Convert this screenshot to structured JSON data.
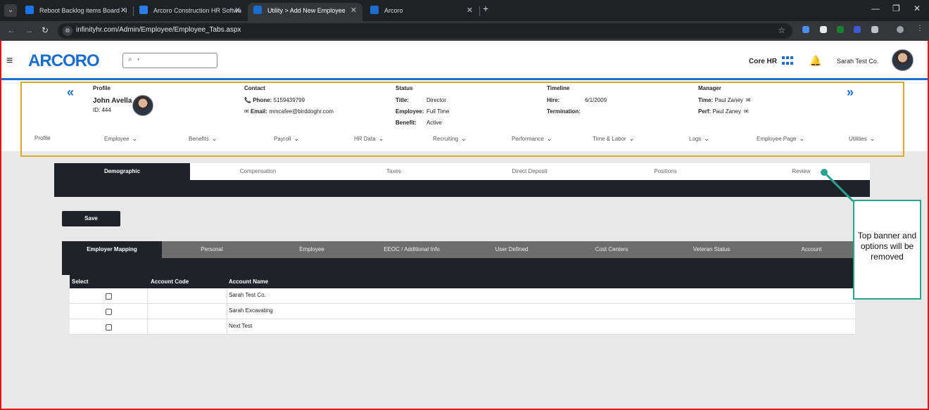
{
  "browser": {
    "tabs": [
      {
        "title": "Reboot Backlog items Board - I",
        "color": "#1a73e8"
      },
      {
        "title": "Arcoro Construction HR Softwa",
        "color": "#2b7de9"
      },
      {
        "title": "Utility > Add New Employee",
        "color": "#1a6dcc",
        "active": true
      },
      {
        "title": "Arcoro",
        "color": "#1a6dcc"
      }
    ],
    "url": "infinityhr.com/Admin/Employee/Employee_Tabs.aspx"
  },
  "header": {
    "logo": "ARCORO",
    "search_placeholder": "*",
    "module": "Core HR",
    "company": "Sarah Test Co."
  },
  "profile": {
    "label": "Profile",
    "name": "John Avella",
    "id": "ID: 444"
  },
  "contact": {
    "label": "Contact",
    "phone_label": "Phone:",
    "phone": "5159439799",
    "email_label": "Email:",
    "email": "mmcafee@birddoghr.com"
  },
  "status": {
    "label": "Status",
    "title_label": "Title:",
    "title": "Director",
    "employee_label": "Employee:",
    "employee": "Full Time",
    "benefit_label": "Benefit:",
    "benefit": "Active"
  },
  "timeline": {
    "label": "Timeline",
    "hire_label": "Hire:",
    "hire": "6/1/2009",
    "termination_label": "Termination:"
  },
  "manager": {
    "label": "Manager",
    "time_label": "Time:",
    "time": "Paul Zaney",
    "perf_label": "Perf:",
    "perf": "Paul Zaney"
  },
  "module_tabs": [
    "Profile",
    "Employee",
    "Benefits",
    "Payroll",
    "HR Data",
    "Recruiting",
    "Performance",
    "Time & Labor",
    "Logs",
    "Employee Page",
    "Utilities"
  ],
  "section_tabs": [
    "Demographic",
    "Compensation",
    "Taxes",
    "Direct Deposit",
    "Positions",
    "Review"
  ],
  "save_label": "Save",
  "sub_tabs": [
    "Employer Mapping",
    "Personal",
    "Employee",
    "EEOC / Additional Info",
    "User Defined",
    "Cost Centers",
    "Veteran Status",
    "Account"
  ],
  "table": {
    "headers": [
      "Select",
      "Account Code",
      "Account Name"
    ],
    "rows": [
      {
        "code": "",
        "name": "Sarah Test Co."
      },
      {
        "code": "",
        "name": "Sarah Excavating"
      },
      {
        "code": "",
        "name": "Next Test"
      }
    ]
  },
  "callout": "Top banner and options will be removed",
  "colors": {
    "accent": "#1a6dcc",
    "highlight": "#e0a723",
    "callout": "#26a68f",
    "dark": "#1f2329"
  }
}
